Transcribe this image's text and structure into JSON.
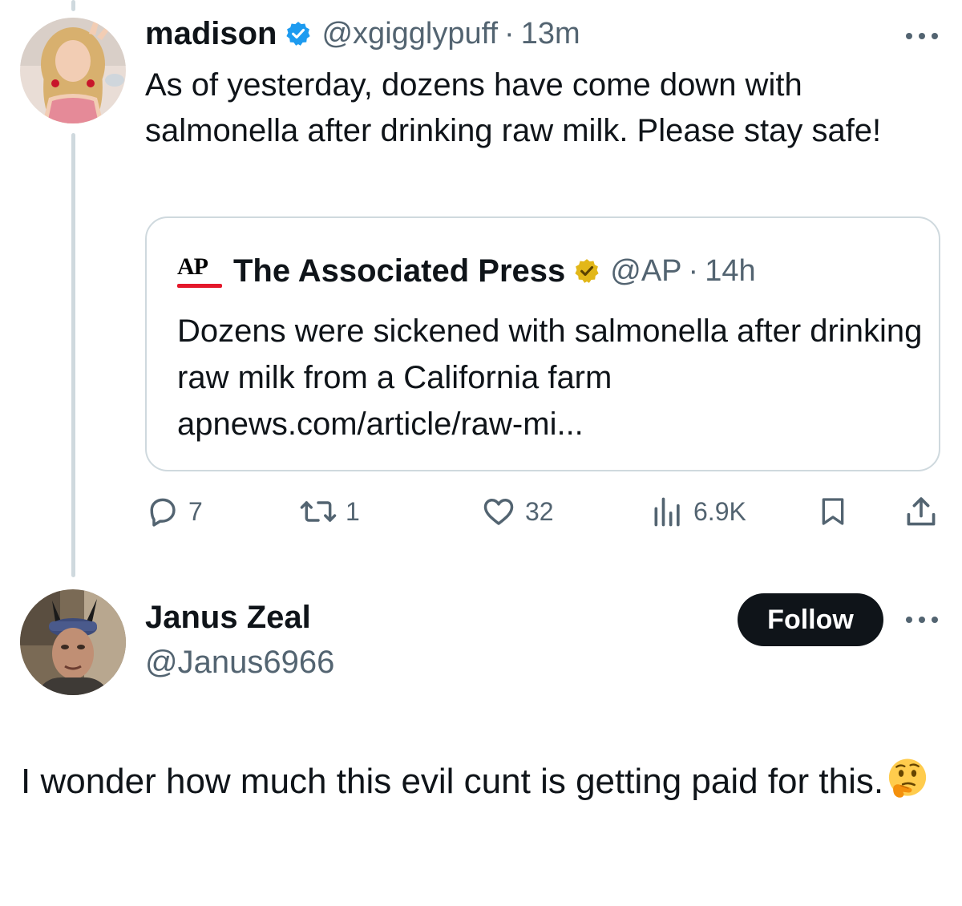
{
  "tweet1": {
    "author_name": "madison",
    "handle": "@xgigglypuff",
    "separator": "·",
    "time": "13m",
    "text": "As of yesterday, dozens have come down with salmonella after drinking raw milk. Please stay safe!",
    "verified_badge": "blue-check-icon",
    "quote": {
      "logo_text": "AP",
      "author_name": "The Associated Press",
      "handle": "@AP",
      "separator": "·",
      "time": "14h",
      "verified_badge": "gold-check-icon",
      "text": "Dozens were sickened with salmonella after drinking raw milk from a California farm apnews.com/article/raw-mi..."
    },
    "actions": {
      "replies": "7",
      "retweets": "1",
      "likes": "32",
      "views": "6.9K"
    }
  },
  "tweet2": {
    "author_name": "Janus Zeal",
    "handle": "@Janus6966",
    "follow_label": "Follow",
    "text": "I wonder how much this evil cunt is getting paid for this.",
    "emoji": "thinking-face-emoji"
  },
  "colors": {
    "text": "#0f1419",
    "secondary": "#536471",
    "verified_blue": "#1d9bf0",
    "verified_gold": "#e2b719",
    "border": "#cfd9de",
    "ap_red": "#e4182b",
    "follow_bg": "#0f1419"
  }
}
